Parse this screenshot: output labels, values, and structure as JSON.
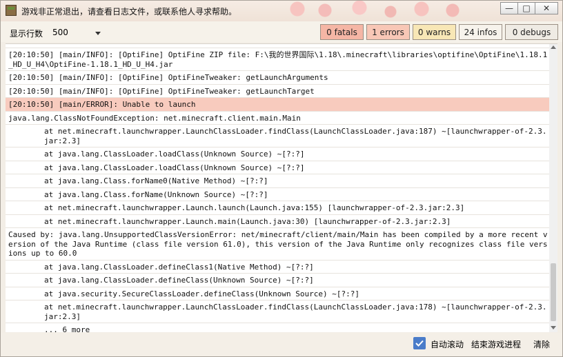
{
  "window": {
    "title": "游戏非正常退出，请查看日志文件，或联系他人寻求帮助。",
    "controls": {
      "minimize": "—",
      "maximize": "□",
      "close": "✕"
    }
  },
  "toolbar": {
    "lines_label": "显示行数",
    "lines_value": "500",
    "filters": {
      "fatals": "0 fatals",
      "errors": "1 errors",
      "warns": "0 warns",
      "infos": "24 infos",
      "debugs": "0 debugs"
    }
  },
  "log": [
    {
      "text": "",
      "type": "cut"
    },
    {
      "text": "[20:10:50] [main/INFO]: [OptiFine] OptiFine ZIP file: F:\\我的世界国际\\1.18\\.minecraft\\libraries\\optifine\\OptiFine\\1.18.1_HD_U_H4\\OptiFine-1.18.1_HD_U_H4.jar",
      "type": "info"
    },
    {
      "text": "[20:10:50] [main/INFO]: [OptiFine] OptiFineTweaker: getLaunchArguments",
      "type": "info"
    },
    {
      "text": "[20:10:50] [main/INFO]: [OptiFine] OptiFineTweaker: getLaunchTarget",
      "type": "info"
    },
    {
      "text": "[20:10:50] [main/ERROR]: Unable to launch",
      "type": "error"
    },
    {
      "text": "java.lang.ClassNotFoundException: net.minecraft.client.main.Main",
      "type": "info"
    },
    {
      "text": "at net.minecraft.launchwrapper.LaunchClassLoader.findClass(LaunchClassLoader.java:187) ~[launchwrapper-of-2.3.jar:2.3]",
      "type": "indent"
    },
    {
      "text": "at java.lang.ClassLoader.loadClass(Unknown Source) ~[?:?]",
      "type": "indent"
    },
    {
      "text": "at java.lang.ClassLoader.loadClass(Unknown Source) ~[?:?]",
      "type": "indent"
    },
    {
      "text": "at java.lang.Class.forName0(Native Method) ~[?:?]",
      "type": "indent"
    },
    {
      "text": "at java.lang.Class.forName(Unknown Source) ~[?:?]",
      "type": "indent"
    },
    {
      "text": "at net.minecraft.launchwrapper.Launch.launch(Launch.java:155) [launchwrapper-of-2.3.jar:2.3]",
      "type": "indent"
    },
    {
      "text": "at net.minecraft.launchwrapper.Launch.main(Launch.java:30) [launchwrapper-of-2.3.jar:2.3]",
      "type": "indent"
    },
    {
      "text": "Caused by: java.lang.UnsupportedClassVersionError: net/minecraft/client/main/Main has been compiled by a more recent version of the Java Runtime (class file version 61.0), this version of the Java Runtime only recognizes class file versions up to 60.0",
      "type": "info"
    },
    {
      "text": "at java.lang.ClassLoader.defineClass1(Native Method) ~[?:?]",
      "type": "indent"
    },
    {
      "text": "at java.lang.ClassLoader.defineClass(Unknown Source) ~[?:?]",
      "type": "indent"
    },
    {
      "text": "at java.security.SecureClassLoader.defineClass(Unknown Source) ~[?:?]",
      "type": "indent"
    },
    {
      "text": "at net.minecraft.launchwrapper.LaunchClassLoader.findClass(LaunchClassLoader.java:178) ~[launchwrapper-of-2.3.jar:2.3]",
      "type": "indent"
    },
    {
      "text": "... 6 more",
      "type": "indent"
    }
  ],
  "bottom": {
    "autoscroll_label": "自动滚动",
    "autoscroll_checked": true,
    "end_process_label": "结束游戏进程",
    "clear_label": "清除"
  },
  "colors": {
    "error_row": "#f8cbbe",
    "fatal_filter": "#f5b6a5",
    "error_filter": "#f8c7b6",
    "warn_filter": "#f8e7b6",
    "checkbox": "#4a7cc9"
  }
}
